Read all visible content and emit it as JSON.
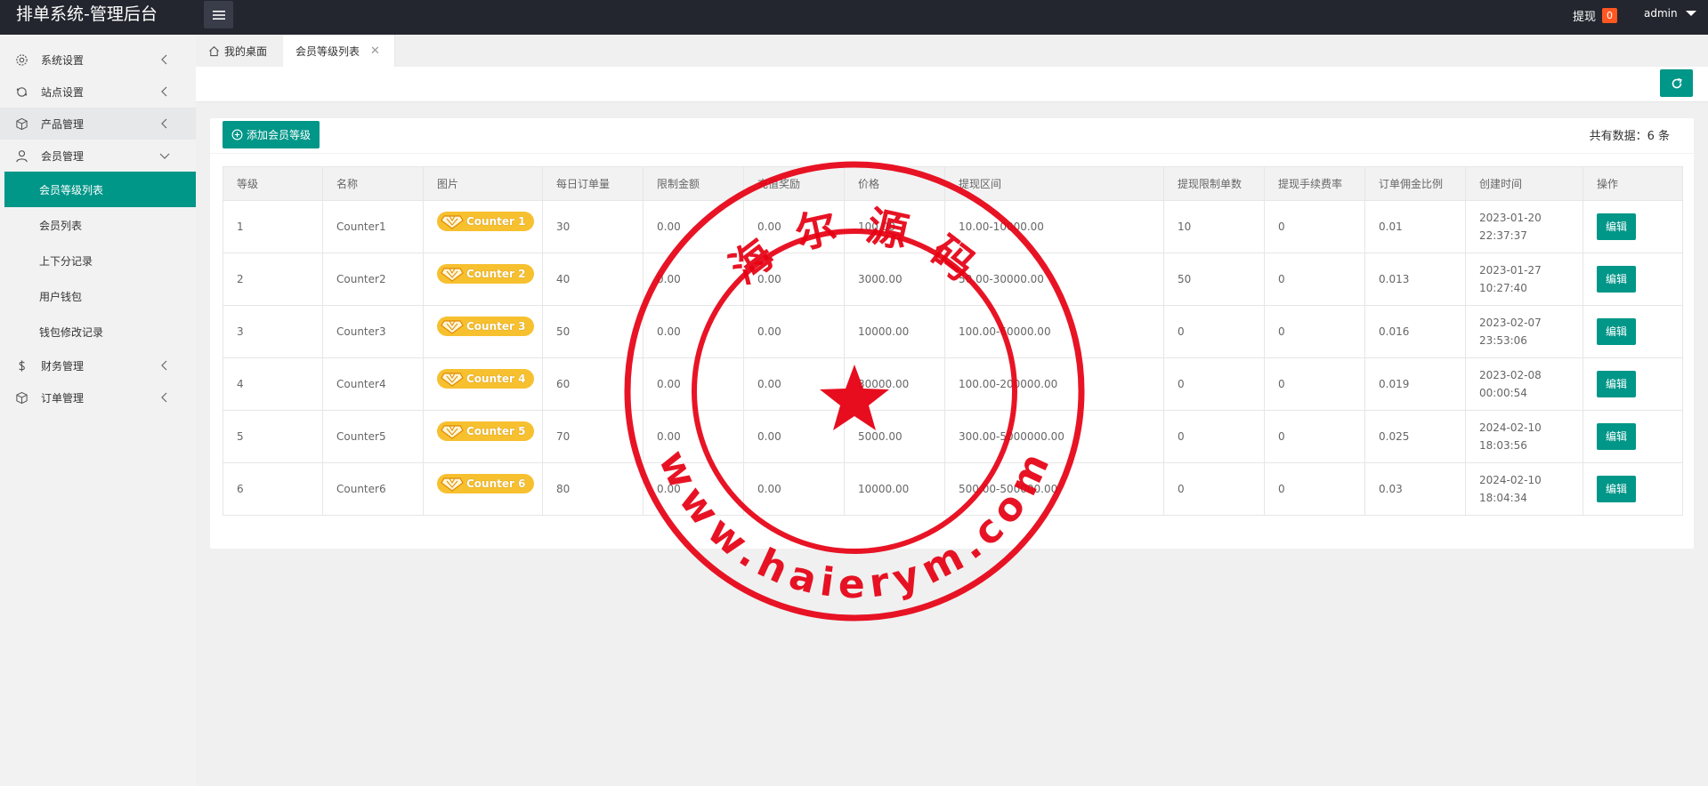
{
  "app": {
    "title": "排单系统-管理后台"
  },
  "header": {
    "withdraw_label": "提现",
    "withdraw_count": "0",
    "user": "admin"
  },
  "sidebar": {
    "items": [
      {
        "label": "系统设置",
        "icon": "gear-icon"
      },
      {
        "label": "站点设置",
        "icon": "site-icon"
      },
      {
        "label": "产品管理",
        "icon": "box-icon"
      },
      {
        "label": "会员管理",
        "icon": "user-icon"
      },
      {
        "label": "财务管理",
        "icon": "dollar-icon"
      },
      {
        "label": "订单管理",
        "icon": "box-icon"
      }
    ],
    "sub_items": [
      "会员等级列表",
      "会员列表",
      "上下分记录",
      "用户钱包",
      "钱包修改记录"
    ]
  },
  "tabs": [
    {
      "label": "我的桌面",
      "icon": "home-icon"
    },
    {
      "label": "会员等级列表"
    }
  ],
  "toolbar": {
    "add_label": "添加会员等级",
    "total_label": "共有数据：6 条"
  },
  "table": {
    "headers": [
      "等级",
      "名称",
      "图片",
      "每日订单量",
      "限制金额",
      "充值奖励",
      "价格",
      "提现区间",
      "提现限制单数",
      "提现手续费率",
      "订单佣金比例",
      "创建时间",
      "操作"
    ],
    "rows": [
      {
        "level": "1",
        "name": "Counter1",
        "badge": "Counter 1",
        "orders": "30",
        "limit": "0.00",
        "reward": "0.00",
        "price": "100.00",
        "range": "10.00-10000.00",
        "wcount": "10",
        "fee": "0",
        "commission": "0.01",
        "created": "2023-01-20 22:37:37",
        "action": "编辑"
      },
      {
        "level": "2",
        "name": "Counter2",
        "badge": "Counter 2",
        "orders": "40",
        "limit": "0.00",
        "reward": "0.00",
        "price": "3000.00",
        "range": "50.00-30000.00",
        "wcount": "50",
        "fee": "0",
        "commission": "0.013",
        "created": "2023-01-27 10:27:40",
        "action": "编辑"
      },
      {
        "level": "3",
        "name": "Counter3",
        "badge": "Counter 3",
        "orders": "50",
        "limit": "0.00",
        "reward": "0.00",
        "price": "10000.00",
        "range": "100.00-60000.00",
        "wcount": "0",
        "fee": "0",
        "commission": "0.016",
        "created": "2023-02-07 23:53:06",
        "action": "编辑"
      },
      {
        "level": "4",
        "name": "Counter4",
        "badge": "Counter 4",
        "orders": "60",
        "limit": "0.00",
        "reward": "0.00",
        "price": "30000.00",
        "range": "100.00-200000.00",
        "wcount": "0",
        "fee": "0",
        "commission": "0.019",
        "created": "2023-02-08 00:00:54",
        "action": "编辑"
      },
      {
        "level": "5",
        "name": "Counter5",
        "badge": "Counter 5",
        "orders": "70",
        "limit": "0.00",
        "reward": "0.00",
        "price": "5000.00",
        "range": "300.00-5000000.00",
        "wcount": "0",
        "fee": "0",
        "commission": "0.025",
        "created": "2024-02-10 18:03:56",
        "action": "编辑"
      },
      {
        "level": "6",
        "name": "Counter6",
        "badge": "Counter 6",
        "orders": "80",
        "limit": "0.00",
        "reward": "0.00",
        "price": "10000.00",
        "range": "500.00-500000.00",
        "wcount": "0",
        "fee": "0",
        "commission": "0.03",
        "created": "2024-02-10 18:04:34",
        "action": "编辑"
      }
    ]
  },
  "watermark": {
    "top_text": "海 尔 源 码",
    "bottom_text": "www.haierym.com"
  },
  "colors": {
    "accent": "#009688",
    "topbar": "#23262e",
    "badge": "#ff5722",
    "stamp": "#e60012",
    "counter_badge": "#f7c02f"
  }
}
